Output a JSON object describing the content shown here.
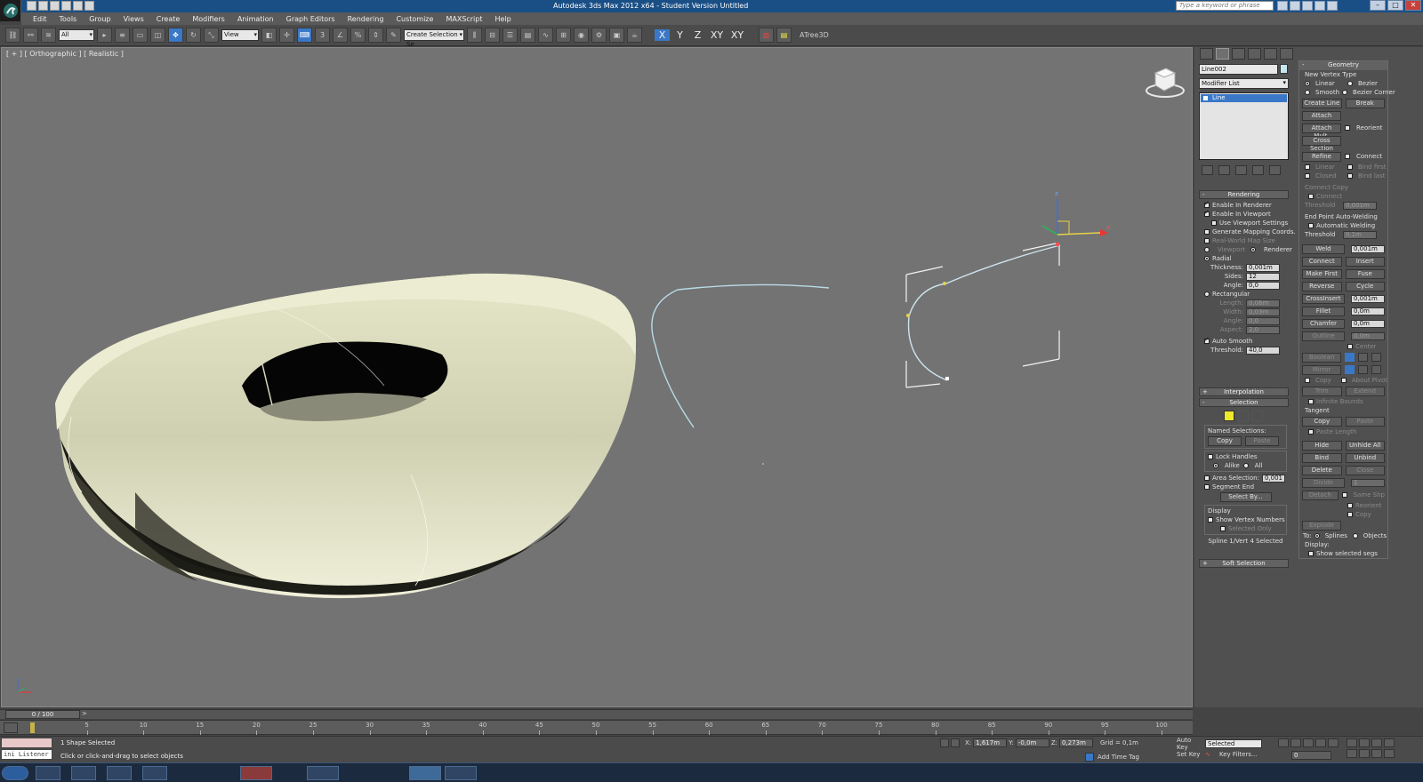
{
  "window": {
    "title": "Autodesk 3ds Max  2012 x64  - Student Version   Untitled",
    "search_placeholder": "Type a keyword or phrase"
  },
  "menu": [
    "Edit",
    "Tools",
    "Group",
    "Views",
    "Create",
    "Modifiers",
    "Animation",
    "Graph Editors",
    "Rendering",
    "Customize",
    "MAXScript",
    "Help"
  ],
  "toolbar": {
    "selection_filter": "All",
    "reference_coord": "View",
    "named_selection": "Create Selection Se",
    "axes": [
      "X",
      "Y",
      "Z",
      "XY",
      "XY"
    ],
    "plugin_label": "ATree3D"
  },
  "viewport": {
    "label": "[ + ] [ Orthographic ] [ Realistic ]"
  },
  "command_panel": {
    "object_name": "Line002",
    "modifier_list": "Modifier List",
    "stack_item": "Line",
    "rendering": {
      "title": "Rendering",
      "enable_renderer": "Enable In Renderer",
      "enable_viewport": "Enable In Viewport",
      "use_viewport_settings": "Use Viewport Settings",
      "gen_mapping": "Generate Mapping Coords.",
      "real_world": "Real-World Map Size",
      "viewport_opt": "Viewport",
      "renderer_opt": "Renderer",
      "radial": "Radial",
      "thickness_label": "Thickness:",
      "thickness": "0,001m",
      "sides_label": "Sides:",
      "sides": "12",
      "angle_label": "Angle:",
      "angle": "0,0",
      "rectangular": "Rectangular",
      "length_label": "Length:",
      "length": "0,06m",
      "width_label": "Width:",
      "width": "0,03m",
      "angle2_label": "Angle:",
      "angle2": "0,0",
      "aspect_label": "Aspect:",
      "aspect": "2,0",
      "auto_smooth": "Auto Smooth",
      "threshold_label": "Threshold:",
      "threshold": "40,0"
    },
    "interpolation_title": "Interpolation",
    "selection": {
      "title": "Selection",
      "named_selections": "Named Selections:",
      "copy": "Copy",
      "paste": "Paste",
      "lock_handles": "Lock Handles",
      "alike": "Alike",
      "all": "All",
      "area_selection": "Area Selection:",
      "area_value": "0,001",
      "segment_end": "Segment End",
      "select_by": "Select By...",
      "display": "Display",
      "show_vertex_numbers": "Show Vertex Numbers",
      "selected_only": "Selected Only",
      "status": "Spline 1/Vert 4 Selected"
    },
    "soft_selection_title": "Soft Selection",
    "geometry": {
      "title": "Geometry",
      "new_vertex_type": "New Vertex Type",
      "linear": "Linear",
      "bezier": "Bezier",
      "smooth": "Smooth",
      "bezier_corner": "Bezier Corner",
      "create_line": "Create Line",
      "break": "Break",
      "attach": "Attach",
      "attach_mult": "Attach Mult.",
      "reorient": "Reorient",
      "cross_section": "Cross Section",
      "refine": "Refine",
      "connect": "Connect",
      "linear2": "Linear",
      "bind_first": "Bind first",
      "closed": "Closed",
      "bind_last": "Bind last",
      "connect_copy": "Connect Copy",
      "connect2": "Connect",
      "threshold_label": "Threshold",
      "threshold": "0,001m",
      "end_point_welding": "End Point Auto-Welding",
      "automatic_welding": "Automatic Welding",
      "threshold2_label": "Threshold",
      "threshold2": "0,1m",
      "weld": "Weld",
      "weld_value": "0,001m",
      "connect3": "Connect",
      "insert": "Insert",
      "make_first": "Make First",
      "fuse": "Fuse",
      "reverse": "Reverse",
      "cycle": "Cycle",
      "crossinsert": "CrossInsert",
      "crossinsert_value": "0,001m",
      "fillet": "Fillet",
      "fillet_value": "0,0m",
      "chamfer": "Chamfer",
      "chamfer_value": "0,0m",
      "outline": "Outline",
      "outline_value": "0,0m",
      "center": "Center",
      "boolean": "Boolean",
      "mirror": "Mirror",
      "copy": "Copy",
      "about_pivot": "About Pivot",
      "trim": "Trim",
      "extend": "Extend",
      "infinite_bounds": "Infinite Bounds",
      "tangent": "Tangent",
      "tcopy": "Copy",
      "tpaste": "Paste",
      "paste_length": "Paste Length",
      "hide": "Hide",
      "unhide_all": "Unhide All",
      "bind": "Bind",
      "unbind": "Unbind",
      "delete": "Delete",
      "close": "Close",
      "divide": "Divide",
      "divide_value": "1",
      "detach": "Detach",
      "same_shp": "Same Shp",
      "reorient2": "Reorient",
      "copy2": "Copy",
      "explode": "Explode",
      "to_label": "To:",
      "splines": "Splines",
      "objects": "Objects",
      "display": "Display:",
      "show_selected_segs": "Show selected segs"
    }
  },
  "timeline": {
    "frame_counter": "0 / 100",
    "ticks": [
      "5",
      "10",
      "15",
      "20",
      "25",
      "30",
      "35",
      "40",
      "45",
      "50",
      "55",
      "60",
      "65",
      "70",
      "75",
      "80",
      "85",
      "90",
      "95",
      "100"
    ]
  },
  "status": {
    "maxscript": "ini Listener",
    "selection": "1 Shape Selected",
    "prompt": "Click or click-and-drag to select objects",
    "x_label": "X:",
    "x": "1,617m",
    "y_label": "Y:",
    "y": "-0,0m",
    "z_label": "Z:",
    "z": "0,273m",
    "grid": "Grid = 0,1m",
    "add_time_tag": "Add Time Tag",
    "auto_key": "Auto Key",
    "auto_key_value": "Selected",
    "set_key": "Set Key",
    "key_filters": "Key Filters...",
    "frame": "0"
  }
}
